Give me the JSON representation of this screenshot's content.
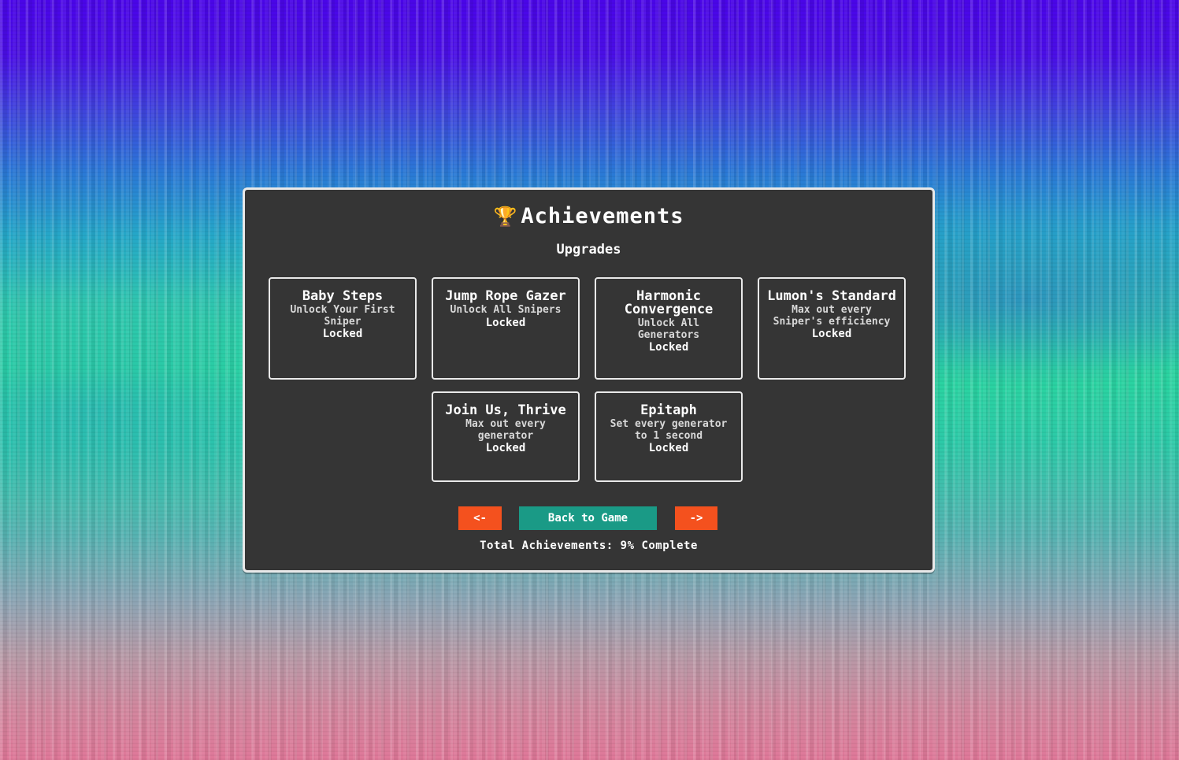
{
  "colors": {
    "panel_bg": "#353535",
    "panel_border": "#e9e9e9",
    "accent_orange": "#f4511e",
    "accent_teal": "#1a9a86",
    "trophy_gold": "#f2c21a"
  },
  "header": {
    "icon": "trophy-icon",
    "title": "Achievements",
    "subtitle": "Upgrades"
  },
  "achievements": [
    {
      "title": "Baby Steps",
      "description": "Unlock Your First Sniper",
      "status": "Locked"
    },
    {
      "title": "Jump Rope Gazer",
      "description": "Unlock All Snipers",
      "status": "Locked"
    },
    {
      "title": "Harmonic Convergence",
      "description": "Unlock All Generators",
      "status": "Locked"
    },
    {
      "title": "Lumon's Standard",
      "description": "Max out every Sniper's efficiency",
      "status": "Locked"
    },
    {
      "title": "Join Us, Thrive",
      "description": "Max out every generator",
      "status": "Locked"
    },
    {
      "title": "Epitaph",
      "description": "Set every generator to 1 second",
      "status": "Locked"
    }
  ],
  "navigation": {
    "prev_label": "<-",
    "back_label": "Back to Game",
    "next_label": "->"
  },
  "footer": {
    "total_text": "Total Achievements: 9% Complete"
  }
}
